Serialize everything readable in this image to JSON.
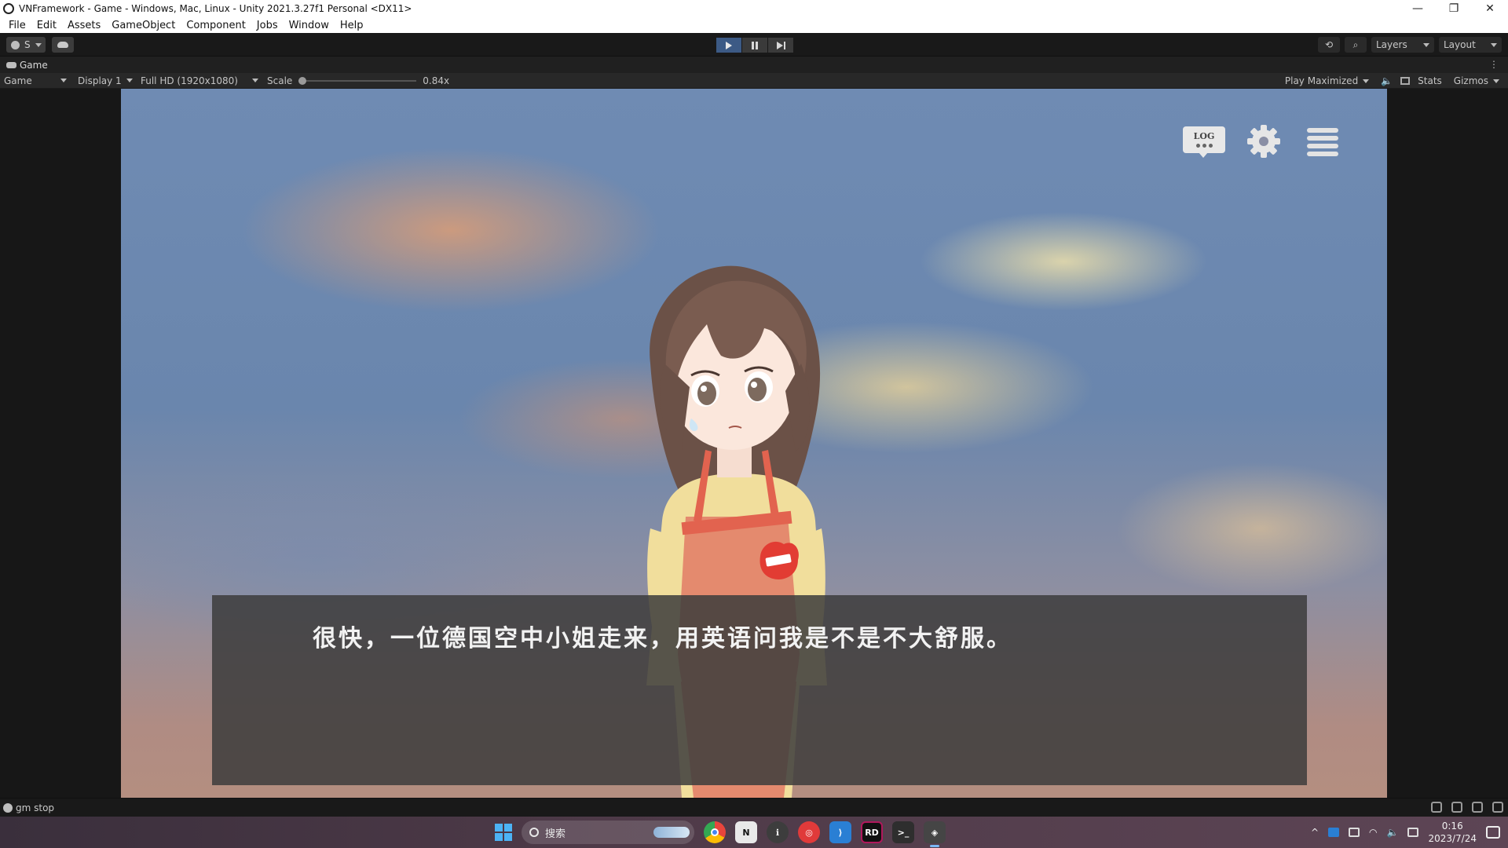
{
  "window": {
    "title": "VNFramework - Game - Windows, Mac, Linux - Unity 2021.3.27f1 Personal <DX11>",
    "minimize_glyph": "—",
    "maximize_glyph": "❐",
    "close_glyph": "✕"
  },
  "menu": {
    "items": [
      {
        "label": "File"
      },
      {
        "label": "Edit"
      },
      {
        "label": "Assets"
      },
      {
        "label": "GameObject"
      },
      {
        "label": "Component"
      },
      {
        "label": "Jobs"
      },
      {
        "label": "Window"
      },
      {
        "label": "Help"
      }
    ]
  },
  "toolbar": {
    "account_label": "S",
    "layers_label": "Layers",
    "layout_label": "Layout",
    "history_glyph": "⟲",
    "search_glyph": "⌕"
  },
  "game_tab": {
    "label": "Game",
    "more_glyph": "⋮"
  },
  "game_view_bar": {
    "view_mode": "Game",
    "display": "Display 1",
    "resolution": "Full HD (1920x1080)",
    "scale_label": "Scale",
    "scale_value": "0.84x",
    "play_mode": "Play Maximized",
    "audio_glyph": "🔈",
    "stats_label": "Stats",
    "gizmos_label": "Gizmos"
  },
  "game": {
    "hud": {
      "log_label": "LOG"
    },
    "dialog_text": "很快，一位德国空中小姐走来，用英语问我是不是不大舒服。"
  },
  "status": {
    "message": "gm stop"
  },
  "taskbar": {
    "search_placeholder": "搜索",
    "apps": [
      {
        "name": "chrome",
        "label": "",
        "color": "#e8453c"
      },
      {
        "name": "notion",
        "label": "N",
        "color": "#2b2b2b"
      },
      {
        "name": "pen-tool",
        "label": "ℹ",
        "color": "#3d3d3d"
      },
      {
        "name": "netease-music",
        "label": "◎",
        "color": "#e03a3a"
      },
      {
        "name": "vscode",
        "label": "⟩",
        "color": "#2a7fd4"
      },
      {
        "name": "rider",
        "label": "RD",
        "color": "#b0185c"
      },
      {
        "name": "terminal",
        "label": ">_",
        "color": "#2e2e2e"
      },
      {
        "name": "unity",
        "label": "◈",
        "color": "#353535"
      }
    ],
    "time": "0:16",
    "date": "2023/7/24",
    "tray_chevron": "^"
  },
  "colors": {
    "play_active": "#3c5a85",
    "dialog_bg": "rgba(60,60,60,0.85)"
  }
}
